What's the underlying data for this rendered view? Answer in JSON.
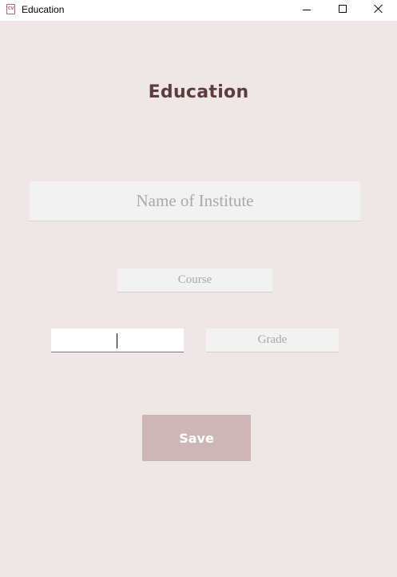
{
  "window": {
    "title": "Education"
  },
  "page": {
    "heading": "Education"
  },
  "form": {
    "institute_placeholder": "Name of Institute",
    "course_placeholder": "Course",
    "year_value": "",
    "grade_placeholder": "Grade",
    "save_label": "Save"
  },
  "colors": {
    "background": "#efe7e7",
    "heading": "#5a3e3e",
    "save_button": "#cdb6b6",
    "field_background": "#f2f2f2",
    "placeholder_text": "#a9a9a9"
  },
  "icons": {
    "app": "cv-document-icon",
    "minimize": "minimize-icon",
    "maximize": "maximize-icon",
    "close": "close-icon"
  }
}
